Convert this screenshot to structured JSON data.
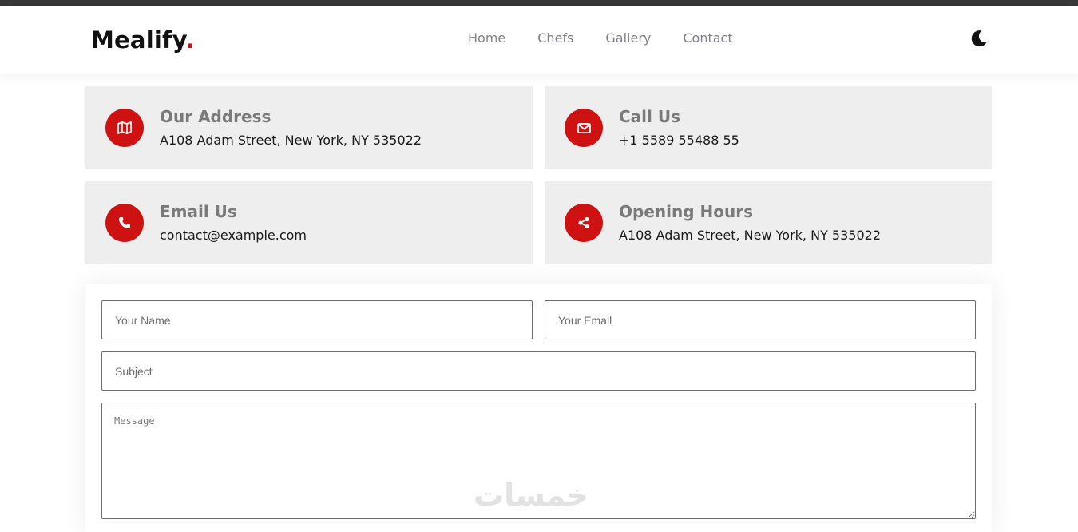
{
  "brand": {
    "name": "Mealify",
    "dot": ".",
    "dot_color": "#ce1212"
  },
  "nav": {
    "items": [
      "Home",
      "Chefs",
      "Gallery",
      "Contact"
    ]
  },
  "theme_toggle": {
    "icon": "moon-icon"
  },
  "info_cards": [
    {
      "title": "Our Address",
      "value": "A108 Adam Street, New York, NY 535022",
      "icon": "map-icon"
    },
    {
      "title": "Call Us",
      "value": "+1 5589 55488 55",
      "icon": "envelope-icon"
    },
    {
      "title": "Email Us",
      "value": "contact@example.com",
      "icon": "phone-icon"
    },
    {
      "title": "Opening Hours",
      "value": "A108 Adam Street, New York, NY 535022",
      "icon": "share-icon"
    }
  ],
  "form": {
    "name_placeholder": "Your Name",
    "email_placeholder": "Your Email",
    "subject_placeholder": "Subject",
    "message_placeholder": "Message"
  },
  "watermark": {
    "text": "خمسات"
  },
  "colors": {
    "accent": "#ce1212",
    "card_bg": "#eeeeee",
    "nav_text": "#7f7f90"
  }
}
